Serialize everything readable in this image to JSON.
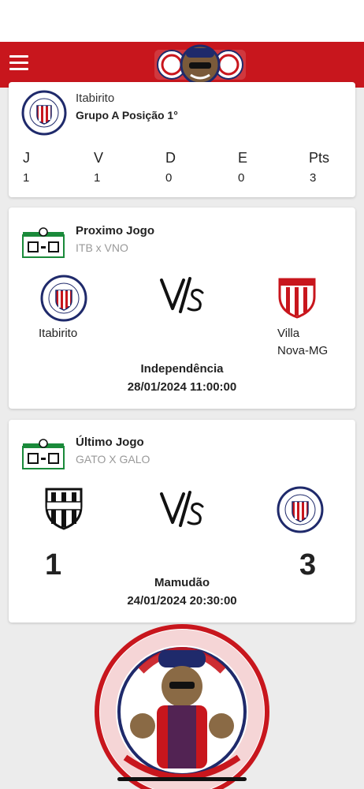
{
  "header": {
    "menu_icon": "hamburger-icon",
    "logo": "torcida-logo"
  },
  "standings": {
    "team": "Itabirito",
    "group_position": "Grupo A Posição 1°",
    "columns": [
      {
        "label": "J",
        "value": "1"
      },
      {
        "label": "V",
        "value": "1"
      },
      {
        "label": "D",
        "value": "0"
      },
      {
        "label": "E",
        "value": "0"
      },
      {
        "label": "Pts",
        "value": "3"
      }
    ]
  },
  "next_match": {
    "title": "Proximo Jogo",
    "code": "ITB x VNO",
    "home_team": "Itabirito",
    "away_team_line1": "Villa",
    "away_team_line2": "Nova-MG",
    "venue": "Independência",
    "datetime": "28/01/2024 11:00:00"
  },
  "last_match": {
    "title": "Último Jogo",
    "code": "GATO X GALO",
    "home_score": "1",
    "away_score": "3",
    "venue": "Mamudão",
    "datetime": "24/01/2024 20:30:00"
  },
  "colors": {
    "brand_red": "#c8161d",
    "navy": "#1f2a6b",
    "stadium_green": "#1a8a3a"
  }
}
